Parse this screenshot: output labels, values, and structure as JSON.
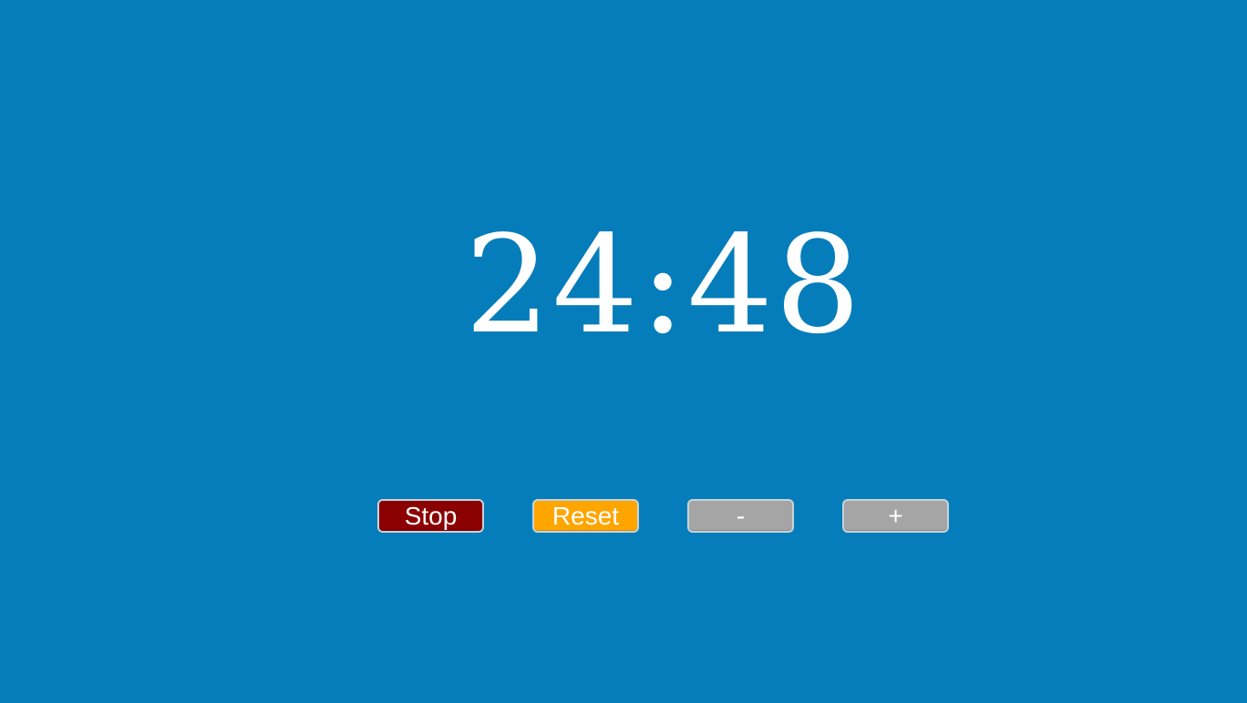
{
  "timer": {
    "display": "24:48"
  },
  "controls": {
    "stop_label": "Stop",
    "reset_label": "Reset",
    "decrease_label": "-",
    "increase_label": "+"
  },
  "colors": {
    "background": "#057dba",
    "timer_text": "#ffffff",
    "stop_button": "#8b0000",
    "reset_button": "#ffa500",
    "adjust_buttons": "#a5a5a5"
  }
}
